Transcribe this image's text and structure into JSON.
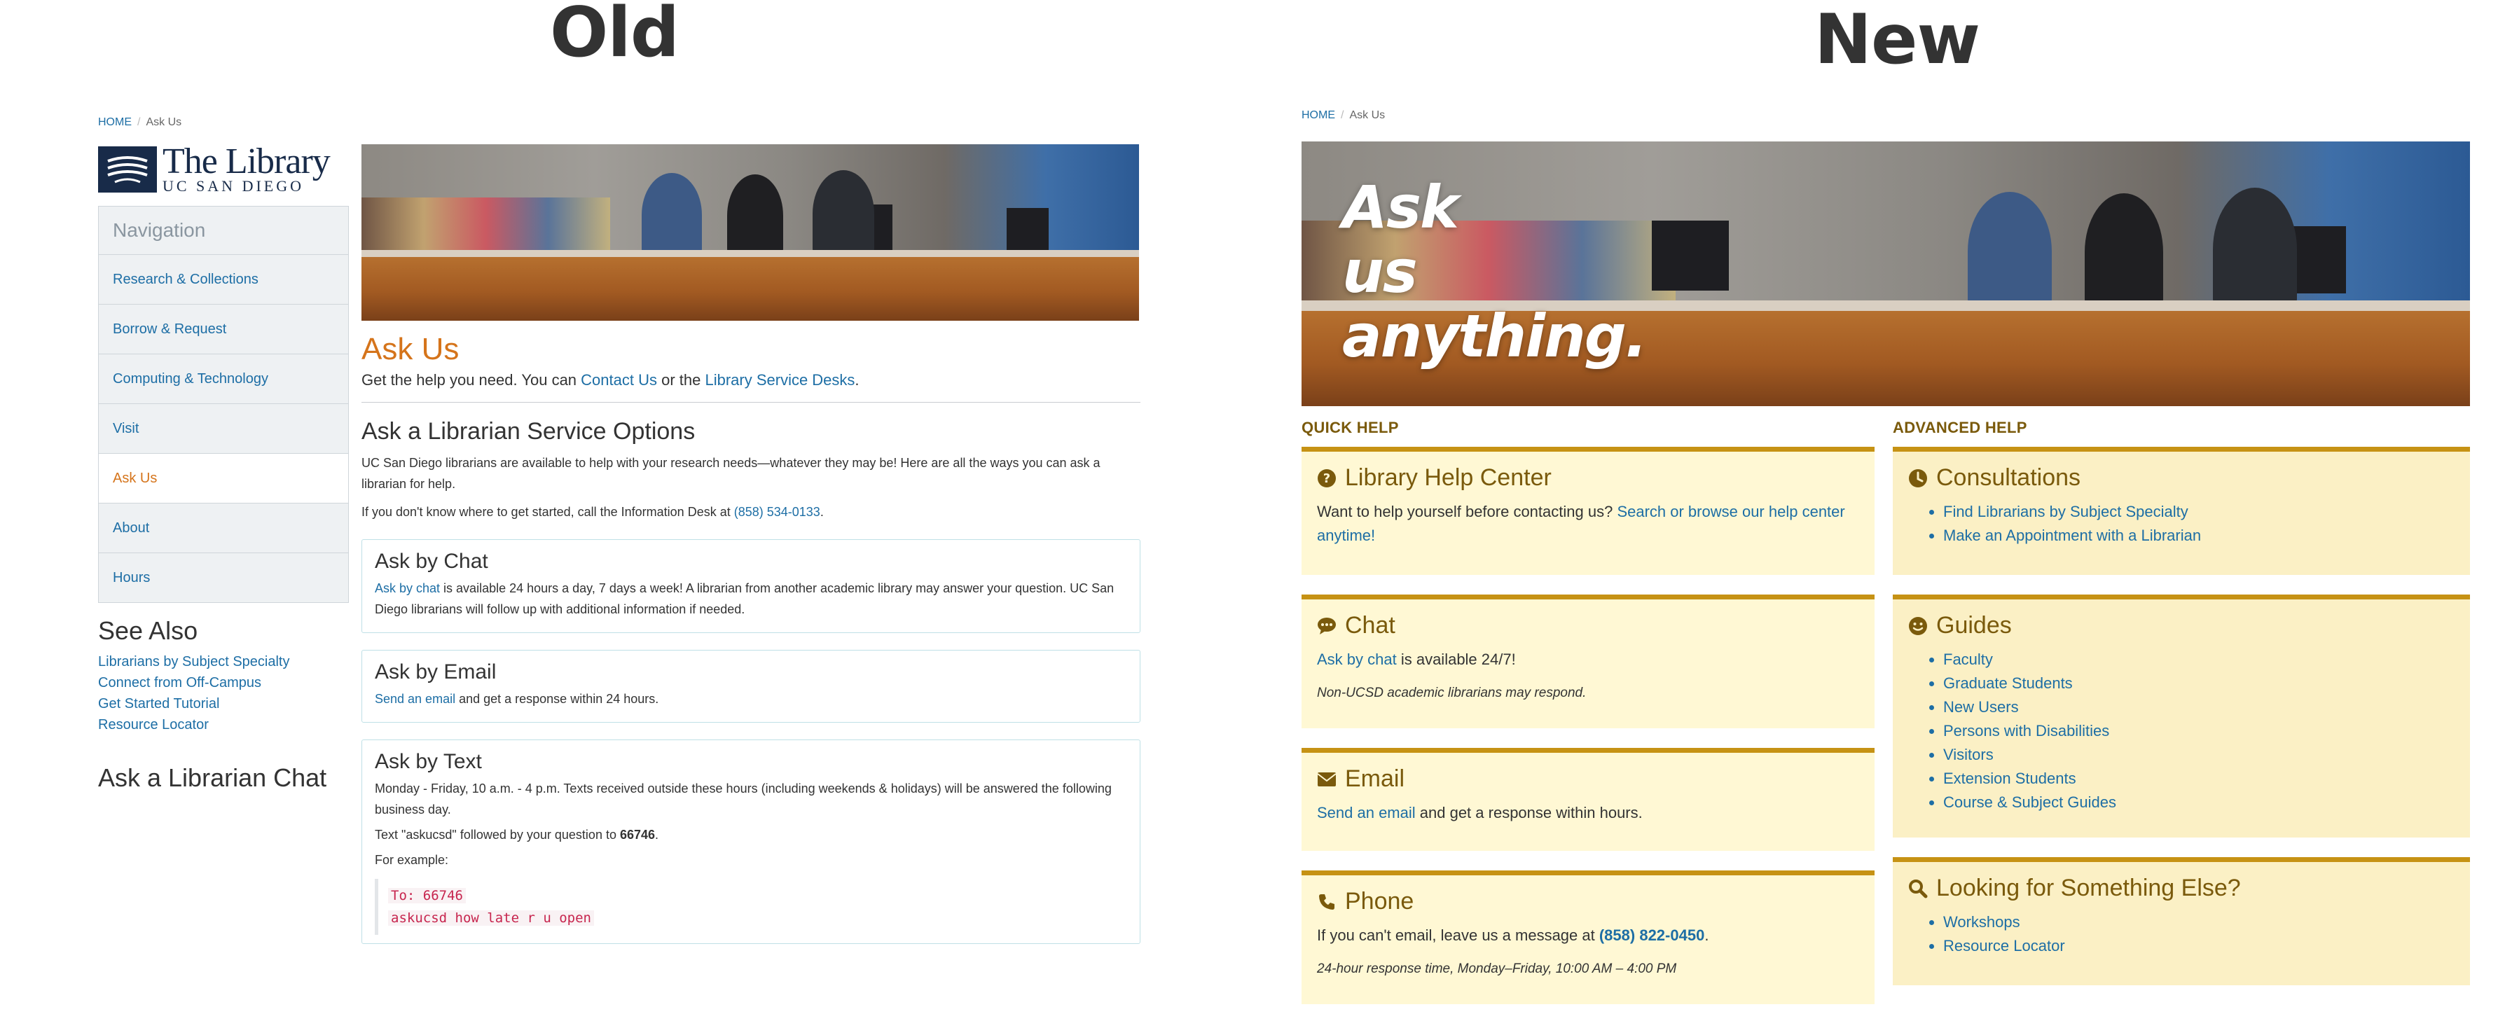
{
  "labels": {
    "old": "Old",
    "new": "New"
  },
  "old": {
    "breadcrumb": {
      "home": "HOME",
      "current": "Ask Us"
    },
    "logo": {
      "title": "The Library",
      "subtitle": "UC SAN DIEGO"
    },
    "navigation": {
      "heading": "Navigation",
      "items": [
        {
          "label": "Research & Collections"
        },
        {
          "label": "Borrow & Request"
        },
        {
          "label": "Computing & Technology"
        },
        {
          "label": "Visit"
        },
        {
          "label": "Ask Us"
        },
        {
          "label": "About"
        },
        {
          "label": "Hours"
        }
      ]
    },
    "see_also": {
      "heading": "See Also",
      "links": [
        "Librarians by Subject Specialty",
        "Connect from Off-Campus",
        "Get Started Tutorial",
        "Resource Locator"
      ]
    },
    "chat_heading": "Ask a Librarian Chat",
    "title": "Ask Us",
    "intro": {
      "before": "Get the help you need. You can ",
      "link1": "Contact Us",
      "middle": " or the ",
      "link2": "Library Service Desks",
      "after": "."
    },
    "service_options": {
      "heading": "Ask a Librarian Service Options",
      "p1": "UC San Diego librarians are available to help with your research needs—whatever they may be! Here are all the ways you can ask a librarian for help.",
      "p2_before": "If you don't know where to get started, call the Information Desk at ",
      "p2_phone": "(858) 534-0133",
      "p2_after": "."
    },
    "chat_box": {
      "heading": "Ask by Chat",
      "link": "Ask by chat",
      "text": " is available 24 hours a day, 7 days a week! A librarian from another academic library may answer your question. UC San Diego librarians will follow up with additional information if needed."
    },
    "email_box": {
      "heading": "Ask by Email",
      "link": "Send an email",
      "text": " and get a response within 24 hours."
    },
    "text_box": {
      "heading": "Ask by Text",
      "p1": "Monday - Friday, 10 a.m. - 4 p.m.  Texts received outside these hours (including weekends & holidays) will be answered the following business day.",
      "p2_before": "Text \"askucsd\" followed by your question to ",
      "p2_number": "66746",
      "p2_after": ".",
      "p3": "For example:",
      "code_line1": "To: 66746",
      "code_line2": "askucsd how late r u open"
    }
  },
  "new": {
    "breadcrumb": {
      "home": "HOME",
      "current": "Ask Us"
    },
    "hero_lines": [
      "Ask",
      "us",
      "anything."
    ],
    "quick_help": {
      "heading": "QUICK HELP",
      "help_center": {
        "title": "Library Help Center",
        "icon": "question-circle-icon",
        "text": "Want to help yourself before contacting us? ",
        "link": "Search or browse our help center anytime!"
      },
      "chat": {
        "title": "Chat",
        "icon": "comment-icon",
        "link": "Ask by chat",
        "text": " is available 24/7!",
        "note": "Non-UCSD academic librarians may respond."
      },
      "email": {
        "title": "Email",
        "icon": "envelope-icon",
        "link": "Send an email",
        "text": " and get a response within hours."
      },
      "phone": {
        "title": "Phone",
        "icon": "phone-icon",
        "text": "If you can't email, leave us a message at ",
        "number": "(858) 822-0450",
        "after": ".",
        "note": "24-hour response time, Monday–Friday, 10:00 AM – 4:00 PM"
      }
    },
    "advanced_help": {
      "heading": "ADVANCED HELP",
      "consultations": {
        "title": "Consultations",
        "icon": "clock-icon",
        "links": [
          "Find Librarians by Subject Specialty",
          "Make an Appointment with a Librarian"
        ]
      },
      "guides": {
        "title": "Guides",
        "icon": "smile-icon",
        "links": [
          "Faculty",
          "Graduate Students",
          "New Users",
          "Persons with Disabilities",
          "Visitors",
          "Extension Students",
          "Course & Subject Guides"
        ]
      },
      "looking": {
        "title": "Looking for Something Else?",
        "icon": "search-icon",
        "links": [
          "Workshops",
          "Resource Locator"
        ]
      }
    }
  },
  "colors": {
    "ucsd_navy": "#182B49",
    "old_accent_orange": "#d5741b",
    "link_blue": "#1d6ea5",
    "new_gold_border": "#c69214",
    "new_card_quick": "#fff8d4",
    "new_card_advanced": "#fbf0c5",
    "new_heading_brown": "#7a5a0c"
  }
}
